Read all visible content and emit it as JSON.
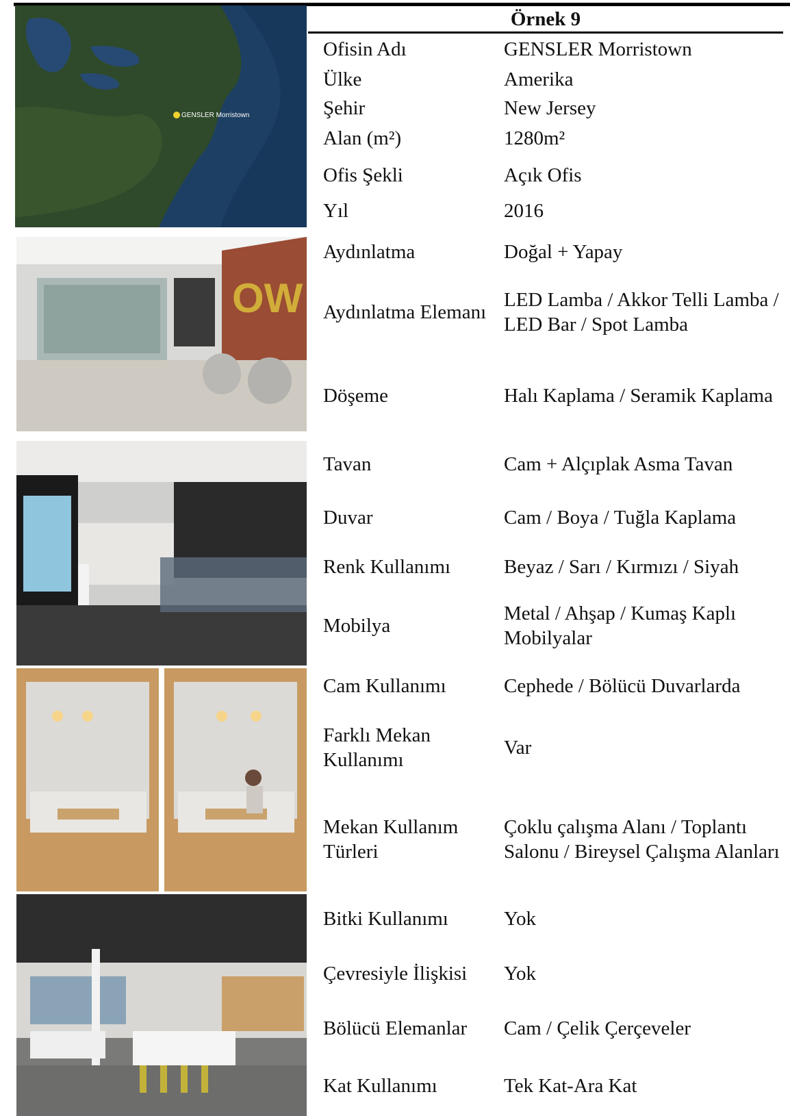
{
  "header": {
    "title": "Örnek 9"
  },
  "map": {
    "pin_label": "GENSLER Morristown"
  },
  "rows": [
    {
      "label": "Ofisin Adı",
      "value": "GENSLER Morristown"
    },
    {
      "label": "Ülke",
      "value": "Amerika"
    },
    {
      "label": "Şehir",
      "value": "New Jersey"
    },
    {
      "label": "Alan (m²)",
      "value": "1280m²"
    },
    {
      "label": "Ofis Şekli",
      "value": "Açık Ofis"
    },
    {
      "label": "Yıl",
      "value": "2016"
    },
    {
      "label": "Aydınlatma",
      "value": "Doğal + Yapay"
    },
    {
      "label": "Aydınlatma Elemanı",
      "value": "LED Lamba / Akkor Telli Lamba / LED Bar / Spot Lamba"
    },
    {
      "label": "Döşeme",
      "value": "Halı Kaplama / Seramik Kaplama"
    },
    {
      "label": "Tavan",
      "value": "Cam + Alçıplak Asma Tavan"
    },
    {
      "label": "Duvar",
      "value": "Cam / Boya / Tuğla Kaplama"
    },
    {
      "label": "Renk Kullanımı",
      "value": "Beyaz / Sarı / Kırmızı / Siyah"
    },
    {
      "label": "Mobilya",
      "value": "Metal / Ahşap / Kumaş Kaplı Mobilyalar"
    },
    {
      "label": "Cam Kullanımı",
      "value": "Cephede / Bölücü Duvarlarda"
    },
    {
      "label": "Farklı Mekan Kullanımı",
      "value": "Var"
    },
    {
      "label": "Mekan Kullanım Türleri",
      "value": "Çoklu çalışma Alanı / Toplantı Salonu / Bireysel Çalışma Alanları"
    },
    {
      "label": "Bitki Kullanımı",
      "value": "Yok"
    },
    {
      "label": "Çevresiyle İlişkisi",
      "value": "Yok"
    },
    {
      "label": "Bölücü Elemanlar",
      "value": "Cam / Çelik Çerçeveler"
    },
    {
      "label": "Kat Kullanımı",
      "value": "Tek Kat-Ara Kat"
    }
  ]
}
